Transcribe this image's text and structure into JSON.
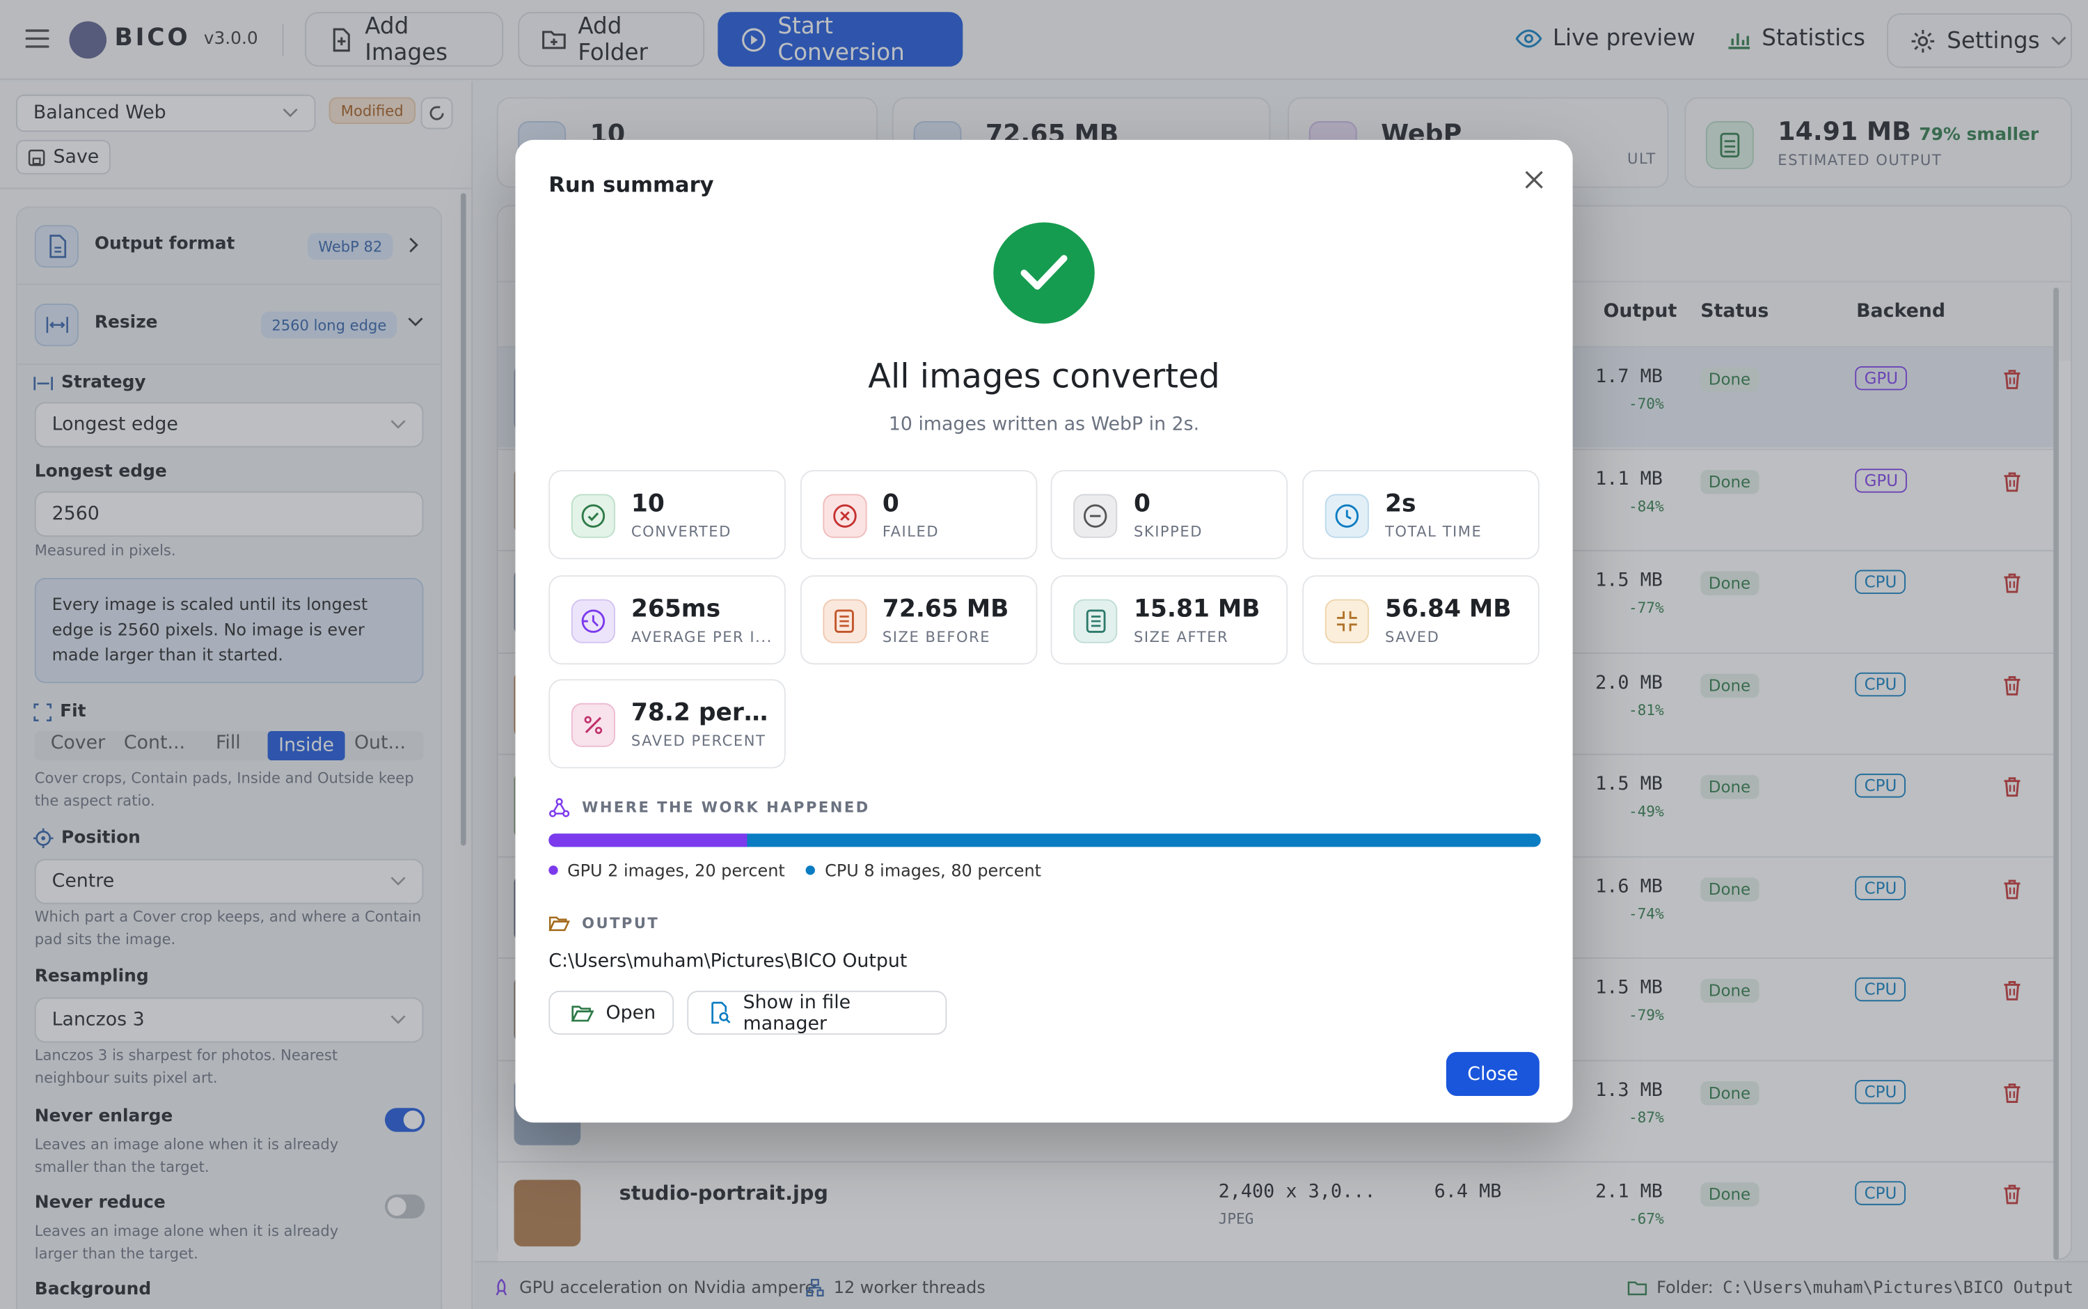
{
  "app": {
    "name": "BICO",
    "version": "v3.0.0"
  },
  "toolbar": {
    "add_images": "Add Images",
    "add_folder": "Add Folder",
    "start_conversion": "Start Conversion",
    "live_preview": "Live preview",
    "statistics": "Statistics",
    "settings": "Settings"
  },
  "preset": {
    "value": "Balanced Web",
    "modified": "Modified",
    "save": "Save"
  },
  "sidebar": {
    "output_format": {
      "title": "Output format",
      "badge": "WebP 82"
    },
    "resize": {
      "title": "Resize",
      "badge": "2560 long edge"
    },
    "strategy": {
      "label": "Strategy",
      "value": "Longest edge"
    },
    "longest_edge": {
      "label": "Longest edge",
      "value": "2560",
      "hint": "Measured in pixels."
    },
    "info": "Every image is scaled until its longest edge is 2560 pixels. No image is ever made larger than it started.",
    "fit": {
      "label": "Fit",
      "options": [
        "Cover",
        "Cont...",
        "Fill",
        "Inside",
        "Out..."
      ],
      "selected": "Inside",
      "hint": "Cover crops, Contain pads, Inside and Outside keep the aspect ratio."
    },
    "position": {
      "label": "Position",
      "value": "Centre",
      "hint": "Which part a Cover crop keeps, and where a Contain pad sits the image."
    },
    "resampling": {
      "label": "Resampling",
      "value": "Lanczos 3",
      "hint": "Lanczos 3 is sharpest for photos. Nearest neighbour suits pixel art."
    },
    "never_enlarge": {
      "label": "Never enlarge",
      "hint": "Leaves an image alone when it is already smaller than the target.",
      "on": true
    },
    "never_reduce": {
      "label": "Never reduce",
      "hint": "Leaves an image alone when it is already larger than the target.",
      "on": false
    },
    "background": {
      "label": "Background"
    }
  },
  "summary_cards": [
    {
      "value": "10",
      "label": ""
    },
    {
      "value": "72.65 MB",
      "label": ""
    },
    {
      "value": "WebP",
      "label": "ULT"
    },
    {
      "value": "14.91 MB",
      "extra": "79% smaller",
      "label": "ESTIMATED OUTPUT"
    }
  ],
  "table": {
    "headers": {
      "output": "Output",
      "status": "Status",
      "backend": "Backend"
    },
    "rows": [
      {
        "output": "1.7 MB",
        "saving": "-70%",
        "status": "Done",
        "backend": "GPU"
      },
      {
        "output": "1.1 MB",
        "saving": "-84%",
        "status": "Done",
        "backend": "GPU"
      },
      {
        "output": "1.5 MB",
        "saving": "-77%",
        "status": "Done",
        "backend": "CPU"
      },
      {
        "output": "2.0 MB",
        "saving": "-81%",
        "status": "Done",
        "backend": "CPU"
      },
      {
        "output": "1.5 MB",
        "saving": "-49%",
        "status": "Done",
        "backend": "CPU"
      },
      {
        "output": "1.6 MB",
        "saving": "-74%",
        "status": "Done",
        "backend": "CPU"
      },
      {
        "output": "1.5 MB",
        "saving": "-79%",
        "status": "Done",
        "backend": "CPU"
      },
      {
        "output": "1.3 MB",
        "saving": "-87%",
        "status": "Done",
        "backend": "CPU"
      },
      {
        "name": "studio-portrait.jpg",
        "dims": "2,400 x 3,0...",
        "format": "JPEG",
        "input": "6.4 MB",
        "output": "2.1 MB",
        "saving": "-67%",
        "status": "Done",
        "backend": "CPU"
      }
    ]
  },
  "statusbar": {
    "gpu": "GPU acceleration on Nvidia ampere",
    "threads": "12 worker threads",
    "folder_label": "Folder:",
    "folder_path": "C:\\Users\\muham\\Pictures\\BICO Output"
  },
  "modal": {
    "title": "Run summary",
    "heading": "All images converted",
    "subheading": "10 images written as WebP in 2s.",
    "stats": [
      {
        "value": "10",
        "label": "CONVERTED",
        "icon": "check-circle-icon"
      },
      {
        "value": "0",
        "label": "FAILED",
        "icon": "x-circle-icon"
      },
      {
        "value": "0",
        "label": "SKIPPED",
        "icon": "minus-circle-icon"
      },
      {
        "value": "2s",
        "label": "TOTAL TIME",
        "icon": "clock-icon"
      },
      {
        "value": "265ms",
        "label": "AVERAGE PER I...",
        "icon": "timer-icon"
      },
      {
        "value": "72.65 MB",
        "label": "SIZE BEFORE",
        "icon": "file-icon"
      },
      {
        "value": "15.81 MB",
        "label": "SIZE AFTER",
        "icon": "file-icon"
      },
      {
        "value": "56.84 MB",
        "label": "SAVED",
        "icon": "shrink-icon"
      },
      {
        "value": "78.2 perc...",
        "label": "SAVED PERCENT",
        "icon": "percent-icon"
      }
    ],
    "work_title": "WHERE THE WORK HAPPENED",
    "work_split": {
      "gpu_fraction": 0.2,
      "gpu_label": "GPU 2 images, 20 percent",
      "cpu_label": "CPU 8 images, 80 percent",
      "gpu_color": "#7c3aed",
      "cpu_color": "#0a7cc2"
    },
    "output_title": "OUTPUT",
    "output_path": "C:\\Users\\muham\\Pictures\\BICO Output",
    "open": "Open",
    "show_in_file_manager": "Show in file manager",
    "close": "Close"
  },
  "colors": {
    "accent": "#1a56db",
    "success": "#16a34a",
    "danger": "#c53030"
  }
}
